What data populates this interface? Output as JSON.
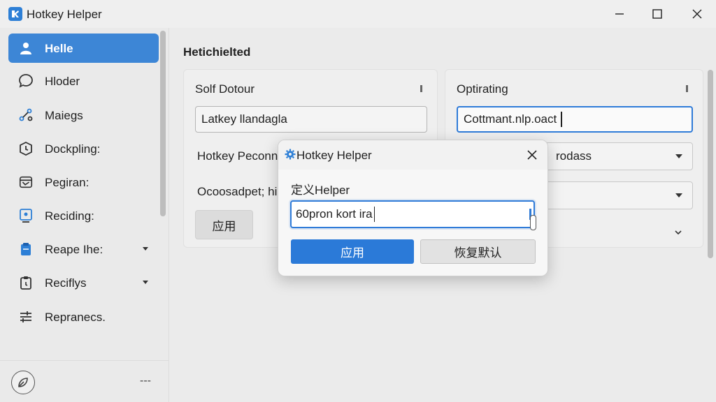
{
  "app": {
    "title": "Hotkey Helper"
  },
  "sidebar": {
    "items": [
      {
        "label": "Helle",
        "icon": "user-icon",
        "active": true
      },
      {
        "label": "Hloder",
        "icon": "chat-bubble-icon"
      },
      {
        "label": "Maiegs",
        "icon": "share-icon"
      },
      {
        "label": "Dockpling:",
        "icon": "timer-icon"
      },
      {
        "label": "Pegiran:",
        "icon": "package-icon"
      },
      {
        "label": "Reciding:",
        "icon": "monitor-icon"
      },
      {
        "label": "Reape Ihe:",
        "icon": "clipboard-icon",
        "expandable": true
      },
      {
        "label": "Reciflys",
        "icon": "clipboard-clock-icon",
        "expandable": true
      },
      {
        "label": "Repranecs.",
        "icon": "sliders-icon"
      }
    ],
    "footer_dash": "---"
  },
  "main": {
    "section_title": "Hetichielted",
    "card_left": {
      "title": "Solf Dotour",
      "input_value": "Latkey llandagla",
      "row1_label": "Hotkey Peconn",
      "row2_label": "Ocoosadpet; hi",
      "button_label": "应用"
    },
    "card_right": {
      "title": "Optirating",
      "input_value": "Cottmant.nlp.oact",
      "select1_value": "rodass"
    }
  },
  "dialog": {
    "title": "Hotkey Helper",
    "field_label": "定义Helper",
    "input_value": "60pron kort ira",
    "apply_label": "应用",
    "reset_label": "恢复默认"
  },
  "colors": {
    "accent": "#2b7ad8",
    "sidebar_active": "#3d86d6"
  }
}
